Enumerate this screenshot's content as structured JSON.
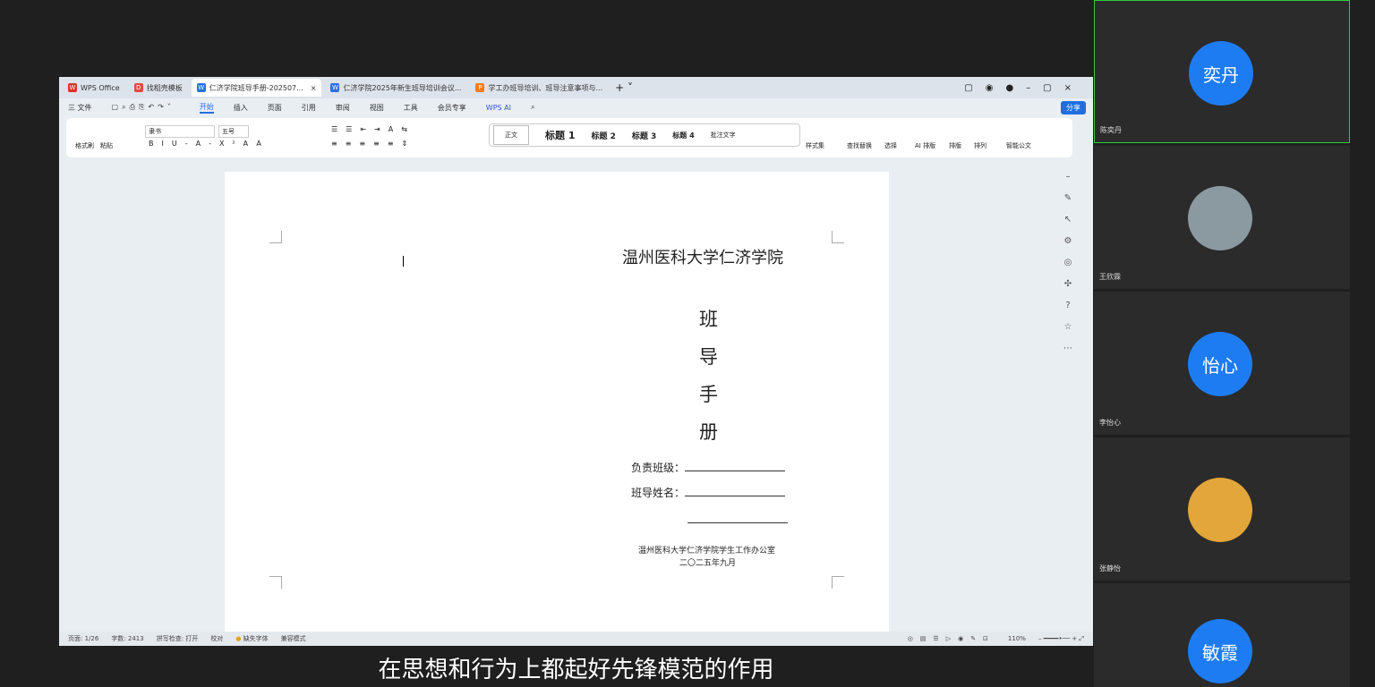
{
  "tabs": [
    {
      "label": "WPS Office",
      "color": "#d9342b"
    },
    {
      "label": "找稻壳模板",
      "color": "#e5483f"
    },
    {
      "label": "仁济学院班导手册-202507...",
      "color": "#2a6ee8"
    },
    {
      "label": "仁济学院2025年新生班导培训会议...",
      "color": "#2a6ee8"
    },
    {
      "label": "学工办班导培训、班导注意事项与...",
      "color": "#f07c1e"
    }
  ],
  "menu": [
    "三 文件",
    "开始",
    "插入",
    "页面",
    "引用",
    "审阅",
    "视图",
    "工具",
    "会员专享",
    "WPS AI"
  ],
  "share_label": "分享",
  "ribbon": {
    "font": "隶书",
    "size": "五号",
    "format_painter": "格式刷",
    "paste": "粘贴",
    "styles": [
      "正文",
      "标题 1",
      "标题 2",
      "标题 3",
      "标题 4",
      "批注文字"
    ],
    "style_set": "样式集",
    "find_replace": "查找替换",
    "select": "选择",
    "ai_layout": "AI 排版",
    "layout": "排版",
    "arrange": "排列",
    "smart_doc": "智能公文"
  },
  "doc": {
    "school": "温州医科大学仁济学院",
    "title_chars": [
      "班",
      "导",
      "手",
      "册"
    ],
    "field1": "负责班级：",
    "field2": "班导姓名：",
    "office": "温州医科大学仁济学院学生工作办公室",
    "date": "二〇二五年九月"
  },
  "status": {
    "page": "页面: 1/26",
    "words": "字数: 2413",
    "spell": "拼写检查: 打开",
    "proof": "校对",
    "missing_font": "缺失字体",
    "compat": "兼容模式",
    "zoom": "110%"
  },
  "participants": [
    {
      "name": "陈奕丹",
      "avatar": "奕丹"
    },
    {
      "name": "王欣霖",
      "avatar": ""
    },
    {
      "name": "李怡心",
      "avatar": "怡心"
    },
    {
      "name": "张静怡",
      "avatar": ""
    },
    {
      "name": "",
      "avatar": "敏霞"
    }
  ],
  "subtitle": "在思想和行为上都起好先锋模范的作用"
}
